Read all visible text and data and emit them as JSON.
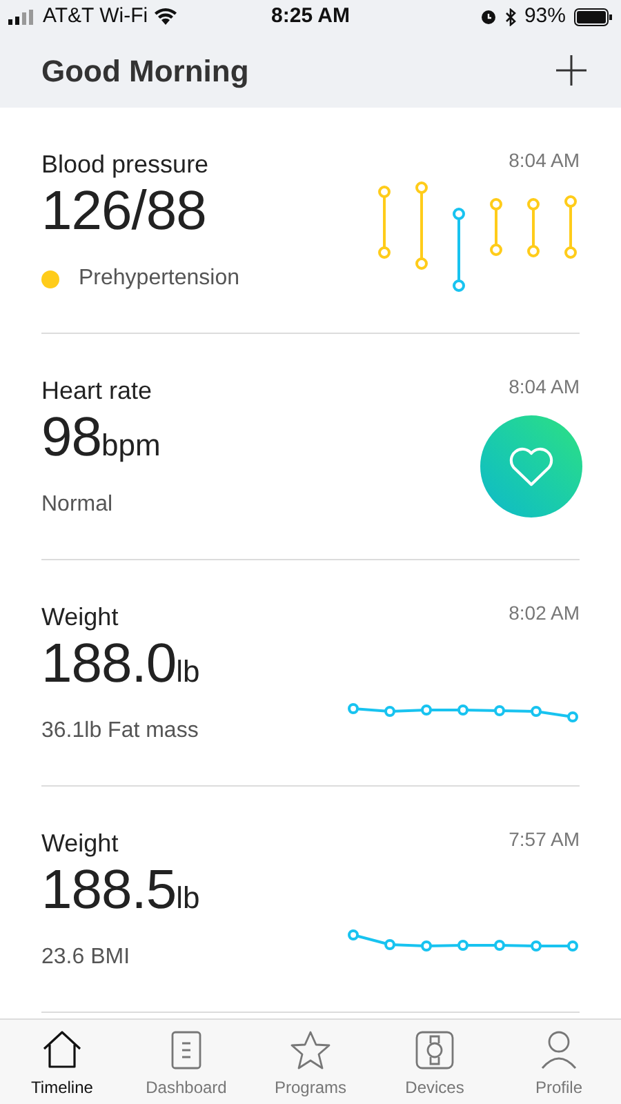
{
  "status_bar": {
    "carrier": "AT&T Wi-Fi",
    "time": "8:25 AM",
    "battery": "93%"
  },
  "header": {
    "title": "Good Morning"
  },
  "cards": [
    {
      "kind": "blood_pressure",
      "title": "Blood pressure",
      "time": "8:04 AM",
      "value": "126/88",
      "note": "Prehypertension",
      "color": "#ffcc1a"
    },
    {
      "kind": "heart",
      "title": "Heart rate",
      "time": "8:04 AM",
      "value": "98",
      "unit": "bpm",
      "note": "Normal"
    },
    {
      "kind": "weight",
      "title": "Weight",
      "time": "8:02 AM",
      "value": "188.0",
      "unit": "lb",
      "note": "36.1lb Fat mass"
    },
    {
      "kind": "weight",
      "title": "Weight",
      "time": "7:57 AM",
      "value": "188.5",
      "unit": "lb",
      "note": "23.6 BMI"
    }
  ],
  "tabs": [
    {
      "label": "Timeline",
      "selected": true
    },
    {
      "label": "Dashboard",
      "selected": false
    },
    {
      "label": "Programs",
      "selected": false
    },
    {
      "label": "Devices",
      "selected": false
    },
    {
      "label": "Profile",
      "selected": false
    }
  ]
}
